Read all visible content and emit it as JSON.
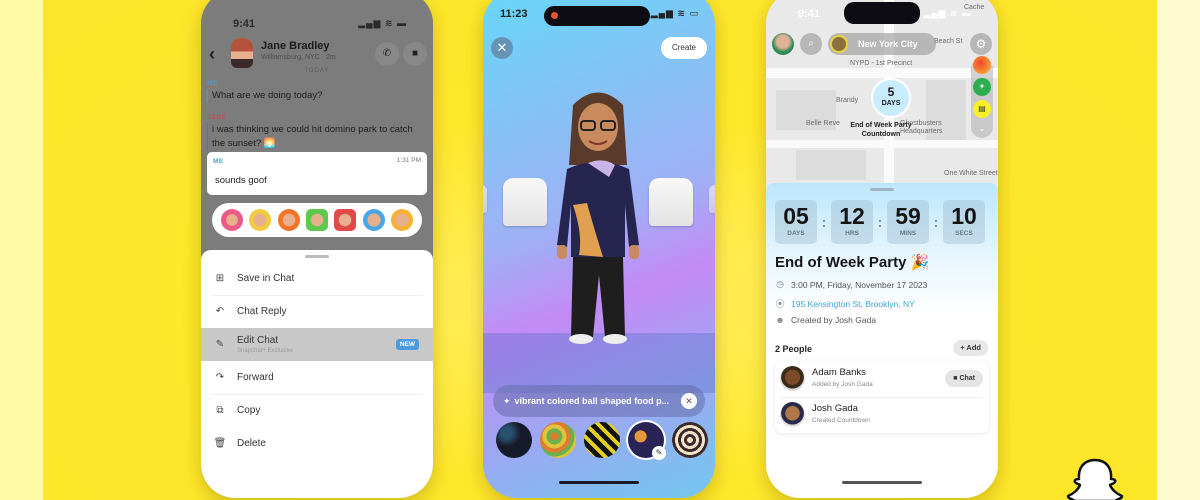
{
  "colors": {
    "background_yellow": "#fde629",
    "snap_blue": "#4a9fcd",
    "jane_red": "#c04b55",
    "new_badge": "#4a9be0",
    "link_blue": "#3da6d6"
  },
  "chat_screen": {
    "status_time": "9:41",
    "status_icons": "▂▄▆ ≋ ▬",
    "back_icon": "‹",
    "contact_name": "Jane Bradley",
    "contact_subtitle": "Williamsburg, NYC · 2m",
    "call_icon": "✆",
    "video_icon": "■",
    "day_divider": "TODAY",
    "messages": [
      {
        "sender": "ME",
        "text": "What are we doing today?"
      },
      {
        "sender": "JANE",
        "text": "i was thinking we could hit domino park to catch the sunset? 🌅"
      }
    ],
    "selected_message": {
      "sender": "ME",
      "timestamp": "1:31 PM",
      "text": "sounds goof"
    },
    "reactions": [
      "heart",
      "smile",
      "fire",
      "thumbs-up",
      "sad",
      "cry",
      "laugh"
    ],
    "menu": [
      {
        "label": "Save in Chat",
        "icon": "⊞",
        "subtitle": "",
        "badge": ""
      },
      {
        "label": "Chat Reply",
        "icon": "↶",
        "subtitle": "",
        "badge": ""
      },
      {
        "label": "Edit Chat",
        "icon": "✎",
        "subtitle": "Snapchat+ Exclusive",
        "badge": "NEW"
      },
      {
        "label": "Forward",
        "icon": "↷",
        "subtitle": "",
        "badge": ""
      },
      {
        "label": "Copy",
        "icon": "⧉",
        "subtitle": "",
        "badge": ""
      },
      {
        "label": "Delete",
        "icon": "🗑",
        "subtitle": "",
        "badge": ""
      }
    ]
  },
  "avatar_screen": {
    "status_time": "11:23",
    "status_icons": "▂▄▆ ≋ ▭",
    "close_icon": "✕",
    "create_label": "Create",
    "prompt_icon": "✦",
    "prompt_text": "vibrant colored ball shaped food p...",
    "prompt_clear_icon": "✕",
    "edit_icon": "✎"
  },
  "map_screen": {
    "status_time": "9:41",
    "status_icons": "▂▄▆ ≋ ▬",
    "search_icon": "⌕",
    "city_name": "New York City",
    "settings_icon": "⚙",
    "map_labels": [
      "NYPD - 1st Precinct",
      "Brandy",
      "Belle Reve",
      "Ghostbusters Headquarters",
      "One White Street",
      "Beach St",
      "Cache"
    ],
    "bubble_number": "5",
    "bubble_unit": "DAYS",
    "bubble_label": "End of Week Party Countdown",
    "countdown": [
      {
        "value": "05",
        "unit": "DAYS"
      },
      {
        "value": "12",
        "unit": "HRS"
      },
      {
        "value": "59",
        "unit": "MINS"
      },
      {
        "value": "10",
        "unit": "SECS"
      }
    ],
    "event_title": "End of Week Party 🎉",
    "event_time": "3:00 PM, Friday, November 17 2023",
    "event_location": "195 Kensington St, Brooklyn, NY",
    "event_creator": "Created by Josh Gada",
    "people_header": "2 People",
    "add_label": "+ Add",
    "people": [
      {
        "name": "Adam Banks",
        "subtitle": "Added by Josh Gada",
        "action": "Chat"
      },
      {
        "name": "Josh Gada",
        "subtitle": "Created Countdown",
        "action": ""
      }
    ]
  }
}
